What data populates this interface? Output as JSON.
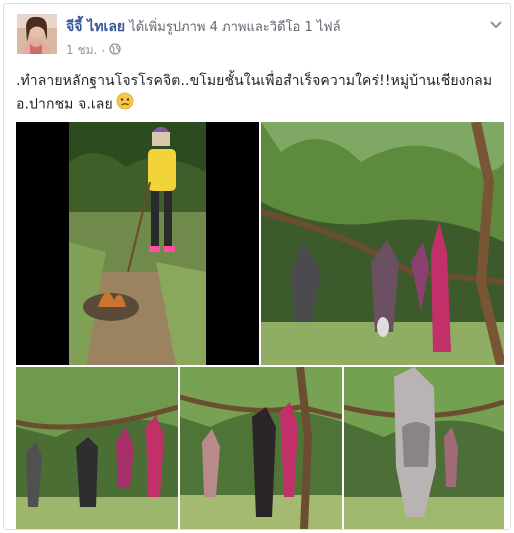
{
  "post": {
    "author": "จีจี้ ไทเลย",
    "action": " ได้เพิ่มรูปภาพ 4 ภาพและวิดีโอ 1 ไฟล์",
    "time": "1 ชม.",
    "separator": "·",
    "text": ".ทำลายหลักฐานโจรโรคจิต..ขโมยชั้นในเพื่อสำเร็จความใคร่!!หมู่บ้านเชียงกลม อ.ปากชม จ.เลย"
  },
  "icons": {
    "privacy": "globe-icon",
    "menu": "chevron-down-icon",
    "emoji": "sad-face-emoji-icon"
  },
  "colors": {
    "author_link": "#365899",
    "meta_gray": "#90949c",
    "border": "#dddfe2"
  }
}
